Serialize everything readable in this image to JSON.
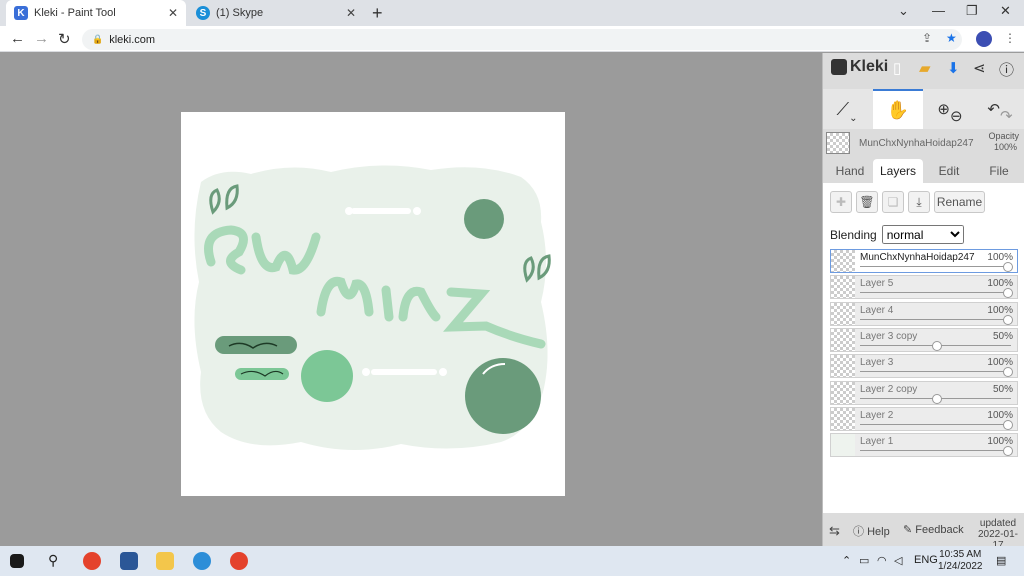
{
  "browser": {
    "tabs": [
      {
        "title": "Kleki - Paint Tool"
      },
      {
        "title": "(1) Skype"
      }
    ],
    "url": "kleki.com"
  },
  "panel": {
    "brand": "Kleki",
    "current_layer": "MunChxNynhaHoidap247",
    "opacity_label": "Opacity",
    "opacity_value": "100%",
    "tabs": [
      "Hand",
      "Layers",
      "Edit",
      "File"
    ],
    "rename_label": "Rename",
    "blending_label": "Blending",
    "blending_value": "normal",
    "layers": [
      {
        "name": "MunChxNynhaHoidap247",
        "opacity": "100%",
        "level": 1.0
      },
      {
        "name": "Layer 5",
        "opacity": "100%",
        "level": 1.0
      },
      {
        "name": "Layer 4",
        "opacity": "100%",
        "level": 1.0
      },
      {
        "name": "Layer 3 copy",
        "opacity": "50%",
        "level": 0.5
      },
      {
        "name": "Layer 3",
        "opacity": "100%",
        "level": 1.0
      },
      {
        "name": "Layer 2 copy",
        "opacity": "50%",
        "level": 0.5
      },
      {
        "name": "Layer 2",
        "opacity": "100%",
        "level": 1.0
      },
      {
        "name": "Layer 1",
        "opacity": "100%",
        "level": 1.0
      }
    ],
    "footer": {
      "help": "Help",
      "feedback": "Feedback",
      "updated_label": "updated",
      "updated_date": "2022-01-17"
    }
  },
  "taskbar": {
    "lang": "ENG",
    "time": "10:35 AM",
    "date": "1/24/2022"
  },
  "colors": {
    "accent": "#3a7bd5",
    "art_green_light": "#a9d9b8",
    "art_green_dark": "#6a9b7b",
    "art_bg": "#e9f1ea"
  }
}
